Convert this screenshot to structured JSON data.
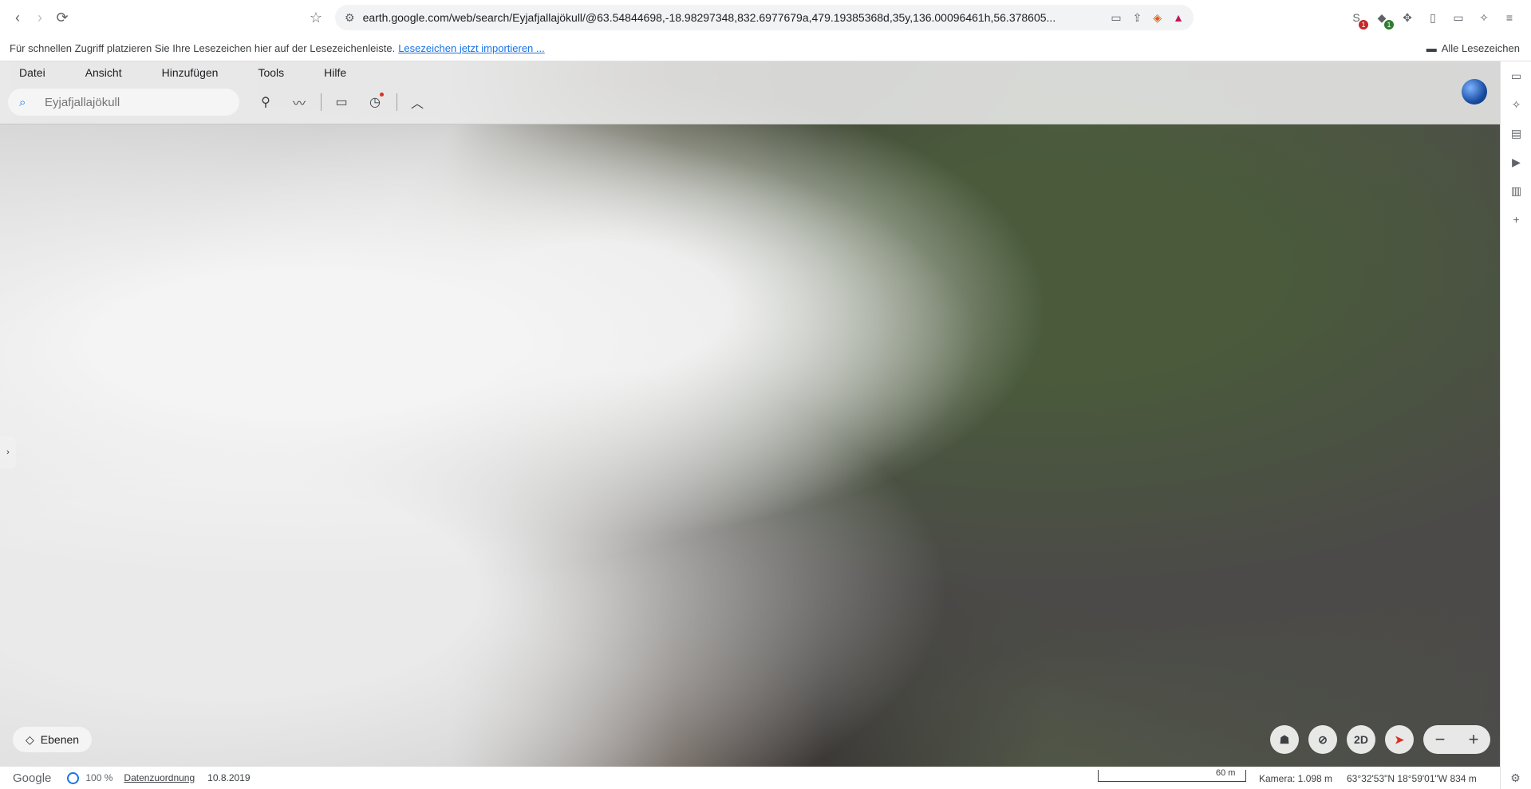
{
  "browser": {
    "url": "earth.google.com/web/search/Eyjafjallajökull/@63.54844698,-18.98297348,832.6977679a,479.19385368d,35y,136.00096461h,56.378605...",
    "bookmark_hint": "Für schnellen Zugriff platzieren Sie Ihre Lesezeichen hier auf der Lesezeichenleiste.",
    "bookmark_import_link": "Lesezeichen jetzt importieren ...",
    "all_bookmarks": "Alle Lesezeichen",
    "extension_badges": [
      "1",
      "1"
    ]
  },
  "menubar": [
    "Datei",
    "Ansicht",
    "Hinzufügen",
    "Tools",
    "Hilfe"
  ],
  "search": {
    "placeholder": "Eyjafjallajökull"
  },
  "controls": {
    "layers_label": "Ebenen",
    "view_2d_label": "2D"
  },
  "status": {
    "logo": "Google",
    "load_pct": "100 %",
    "attribution": "Datenzuordnung",
    "imagery_date": "10.8.2019",
    "scale_label": "60 m",
    "camera": "Kamera: 1.098 m",
    "coordinates": "63°32'53\"N 18°59'01\"W  834 m"
  }
}
